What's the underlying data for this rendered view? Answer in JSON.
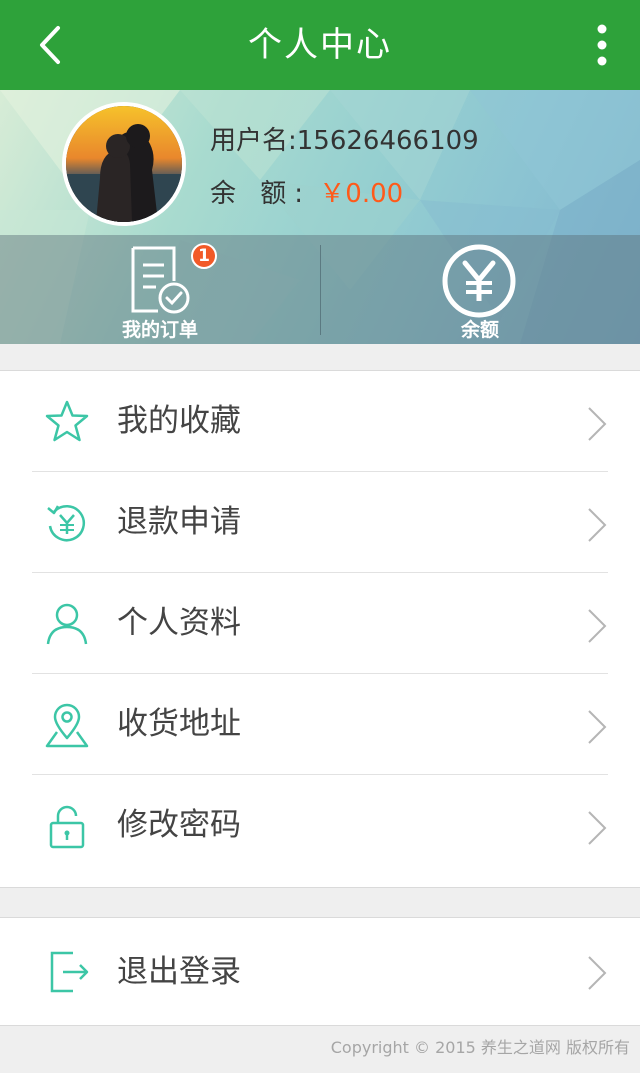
{
  "header": {
    "title": "个人中心",
    "back_icon": "chevron-left-icon",
    "more_icon": "more-vertical-icon",
    "bg_color": "#2ea23a"
  },
  "profile": {
    "username_label": "用户名:",
    "username": "15626466109",
    "balance_label": "余 额:",
    "balance_value": "￥0.00",
    "balance_color": "#ff5a1a"
  },
  "quick_actions": [
    {
      "label": "我的订单",
      "icon": "order-check-icon",
      "badge": "1"
    },
    {
      "label": "余额",
      "icon": "yuan-circle-icon"
    }
  ],
  "menu": [
    {
      "label": "我的收藏",
      "icon": "star-icon"
    },
    {
      "label": "退款申请",
      "icon": "refund-icon"
    },
    {
      "label": "个人资料",
      "icon": "user-icon"
    },
    {
      "label": "收货地址",
      "icon": "location-icon"
    },
    {
      "label": "修改密码",
      "icon": "lock-icon"
    }
  ],
  "logout": {
    "label": "退出登录",
    "icon": "logout-icon"
  },
  "footer": {
    "copyright": "Copyright © 2015 养生之道网 版权所有"
  },
  "colors": {
    "accent": "#2ea23a",
    "icon": "#3cc6a6",
    "price": "#ff5a1a"
  }
}
